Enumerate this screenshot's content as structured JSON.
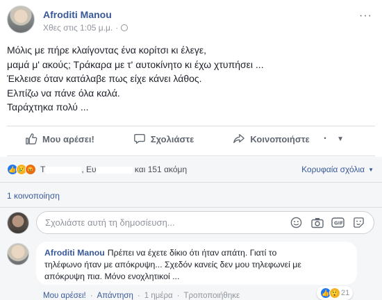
{
  "post": {
    "author": "Afroditi Manou",
    "timestamp": "Χθες στις 1:05 μ.μ.",
    "separator": "·",
    "more": "···",
    "lines": [
      "Μόλις με πήρε κλαίγοντας ένα κορίτσι κι έλεγε,",
      "μαμά μ' ακούς; Τράκαρα με τ' αυτοκίνητο κι έχω χτυπήσει ...",
      "Έκλεισε όταν κατάλαβε πως είχε κάνει λάθος.",
      "Ελπίζω να πάνε όλα καλά.",
      "Ταράχτηκα πολύ ..."
    ]
  },
  "actions": {
    "like": "Μου αρέσει!",
    "comment": "Σχολιάστε",
    "share": "Κοινοποιήστε"
  },
  "reactions": {
    "names_before": "Τ",
    "names_middle": ", Ευ",
    "names_after": "και 151 ακόμη",
    "sort_label": "Κορυφαία σχόλια"
  },
  "shares": "1 κοινοποίηση",
  "composer": {
    "placeholder": "Σχολιάστε αυτή τη δημοσίευση..."
  },
  "comment": {
    "author": "Afroditi Manou",
    "line1": "Πρέπει να έχετε δίκιο ότι ήταν απάτη. Γιατί το",
    "line2": "τηλέφωνο ήταν με απόκρυψη... Σχεδόν κανείς δεν μου τηλεφωνεί με",
    "line3": "απόκρυψη πια. Μόνο ενοχλητικοί ...",
    "reaction_count": "21",
    "like": "Μου αρέσει!",
    "reply": "Απάντηση",
    "time": "1 ημέρα",
    "edited": "Τροποποιήθηκε",
    "dot": "·"
  },
  "colors": {
    "link": "#385898",
    "muted": "#90949c",
    "like_blue": "#2078f4"
  }
}
